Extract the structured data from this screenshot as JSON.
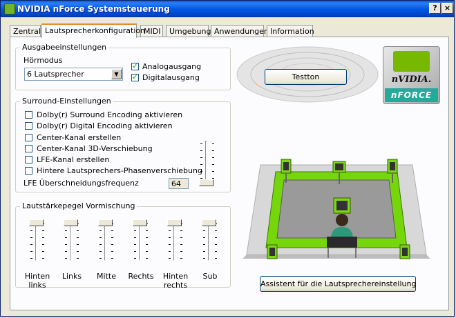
{
  "window": {
    "title": "NVIDIA nForce Systemsteuerung",
    "help_label": "?",
    "close_label": "×"
  },
  "tabs": [
    {
      "label": "Zentral"
    },
    {
      "label": "Lautsprecherkonfiguration"
    },
    {
      "label": "MIDI"
    },
    {
      "label": "Umgebung"
    },
    {
      "label": "Anwendungen"
    },
    {
      "label": "Information"
    }
  ],
  "active_tab": "Lautsprecherkonfiguration",
  "output": {
    "group_label": "Ausgabeeinstellungen",
    "mode_label": "Hörmodus",
    "mode_value": "6 Lautsprecher",
    "analog": {
      "label": "Analogausgang",
      "checked": true
    },
    "digital": {
      "label": "Digitalausgang",
      "checked": true
    },
    "test_button": "Testton"
  },
  "surround": {
    "group_label": "Surround-Einstellungen",
    "options": [
      {
        "label": "Dolby(r) Surround Encoding aktivieren",
        "checked": false
      },
      {
        "label": "Dolby(r) Digital Encoding aktivieren",
        "checked": false
      },
      {
        "label": "Center-Kanal erstellen",
        "checked": false
      },
      {
        "label": "Center-Kanal 3D-Verschiebung",
        "checked": false
      },
      {
        "label": "LFE-Kanal erstellen",
        "checked": false
      },
      {
        "label": "Hintere Lautsprechers-Phasenverschiebung",
        "checked": false
      }
    ],
    "lfe_label": "LFE Überschneidungsfrequenz",
    "lfe_value": "64",
    "lfe_slider_level": 0.0
  },
  "mix": {
    "group_label": "Lautstärkepegel Vormischung",
    "channels": [
      {
        "label_line1": "Hinten",
        "label_line2": "links",
        "level": 1.0
      },
      {
        "label_line1": "Links",
        "label_line2": "",
        "level": 1.0
      },
      {
        "label_line1": "Mitte",
        "label_line2": "",
        "level": 1.0
      },
      {
        "label_line1": "Rechts",
        "label_line2": "",
        "level": 1.0
      },
      {
        "label_line1": "Hinten",
        "label_line2": "rechts",
        "level": 1.0
      },
      {
        "label_line1": "Sub",
        "label_line2": "",
        "level": 1.0
      }
    ]
  },
  "wizard_button": "Assistent für die Lautsprechereinstellung",
  "logo": {
    "wordmark": "nVIDIA.",
    "product": "nFORCE"
  },
  "colors": {
    "accent_green": "#76b900",
    "title_blue": "#0058e6",
    "logo_teal": "#26a89a"
  }
}
